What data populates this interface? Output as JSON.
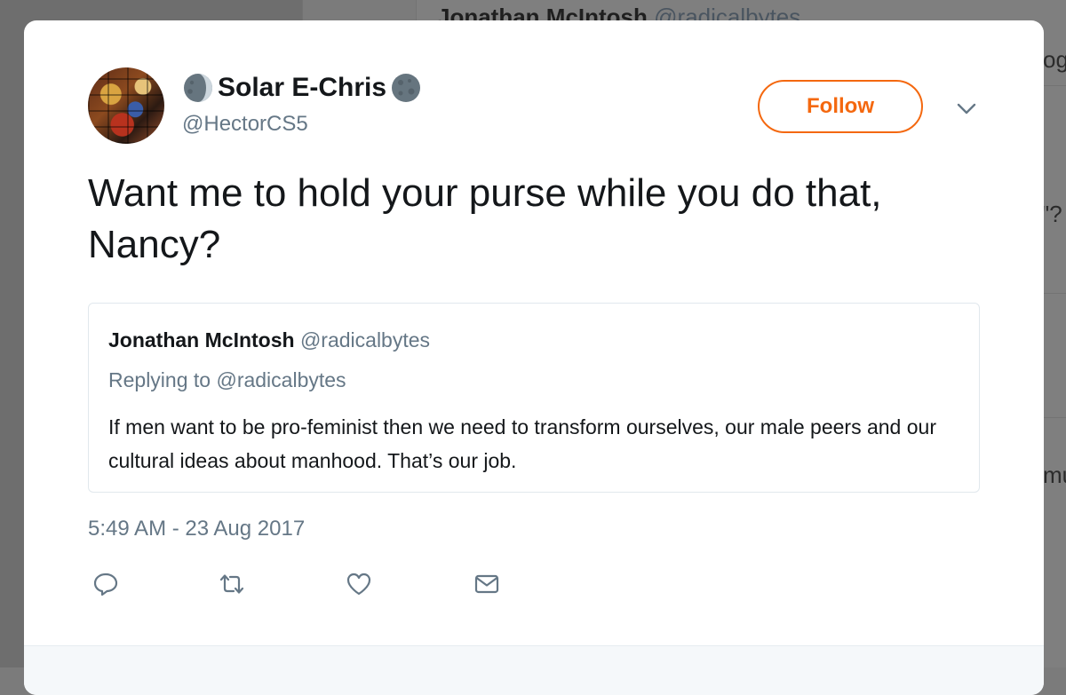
{
  "background": {
    "feed_header_name": "Jonathan McIntosh",
    "feed_header_handle": "@radicalbytes",
    "right_fragments": [
      "og",
      "\"?",
      "mu"
    ]
  },
  "tweet": {
    "author_name": "Solar E-Chris",
    "author_handle": "@HectorCS5",
    "follow_label": "Follow",
    "text": "Want me to hold your purse while you do that, Nancy?",
    "timestamp": "5:49 AM - 23 Aug 2017",
    "quoted": {
      "author_name": "Jonathan McIntosh",
      "author_handle": "@radicalbytes",
      "replying_prefix": "Replying to",
      "replying_handle": "@radicalbytes",
      "text": "If men want to be pro-feminist then we need to transform ourselves, our male peers and our cultural ideas about manhood. That’s our job."
    },
    "actions": [
      "reply-icon",
      "retweet-icon",
      "like-icon",
      "message-icon"
    ]
  },
  "colors": {
    "accent": "#f4680f",
    "secondary_text": "#657786",
    "primary_text": "#14171a",
    "icon": "#657786"
  }
}
